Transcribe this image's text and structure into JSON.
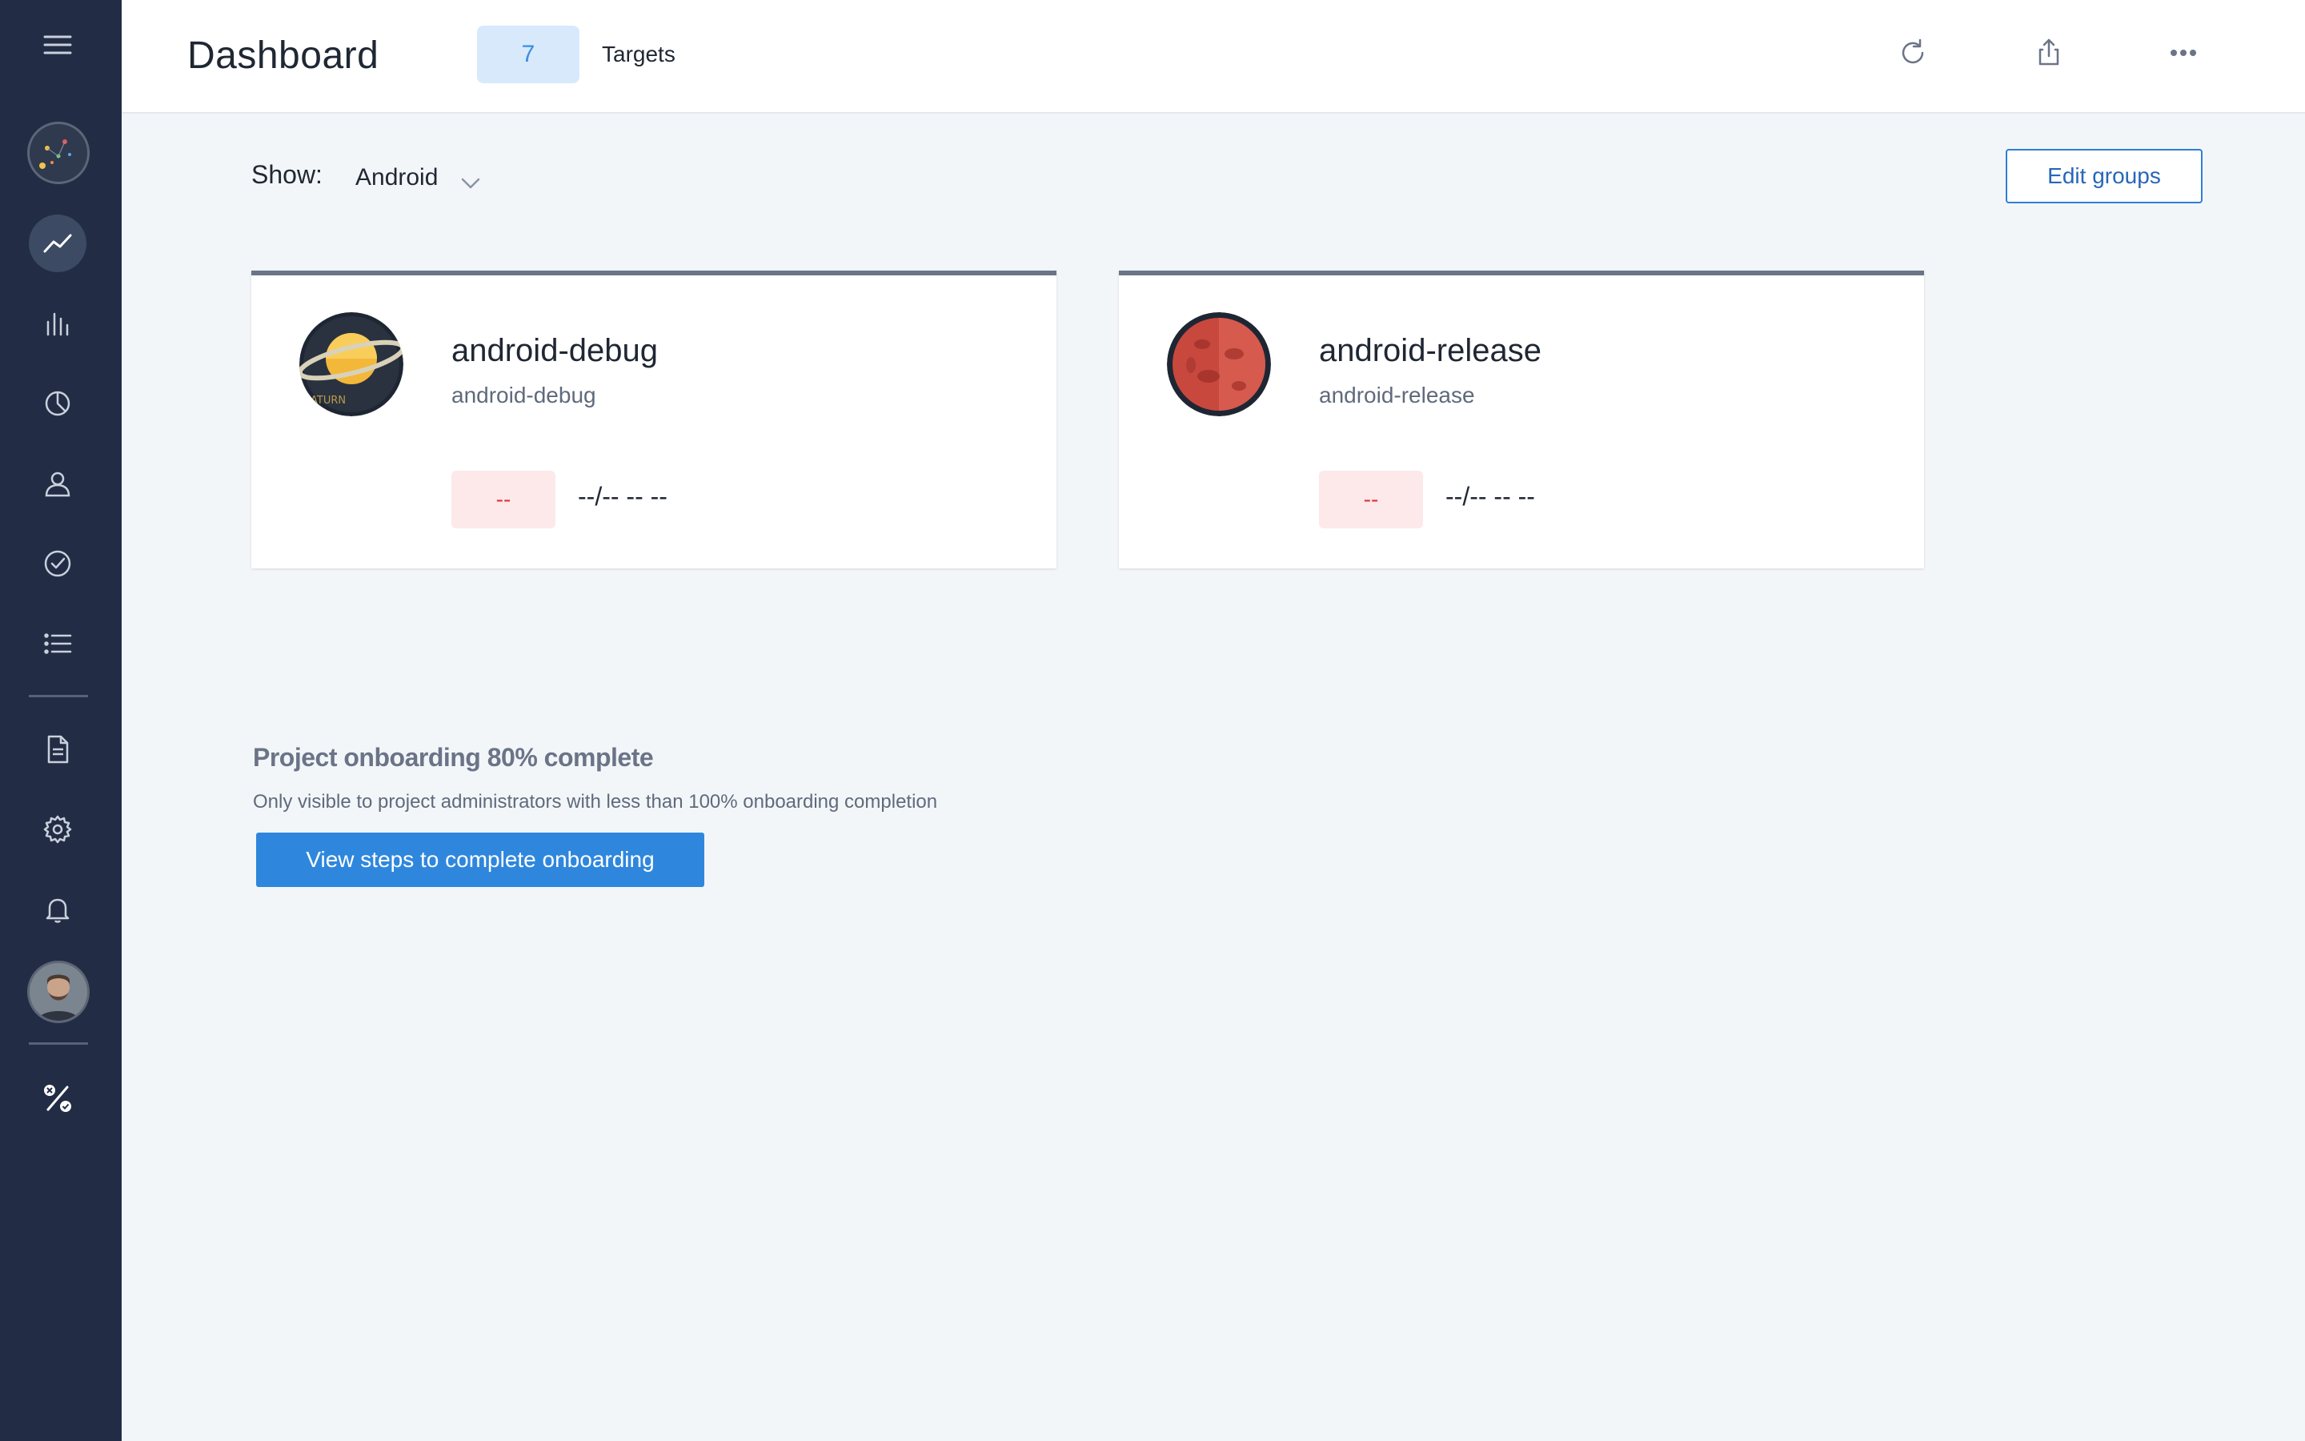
{
  "header": {
    "title": "Dashboard",
    "targets_count": "7",
    "targets_label": "Targets"
  },
  "sidebar": {
    "items": [
      {
        "icon": "menu-icon"
      },
      {
        "icon": "project-logo"
      },
      {
        "icon": "trending-icon",
        "active": true
      },
      {
        "icon": "bar-chart-icon"
      },
      {
        "icon": "pie-chart-icon"
      },
      {
        "icon": "user-icon"
      },
      {
        "icon": "check-circle-icon"
      },
      {
        "icon": "list-icon"
      },
      {
        "icon": "document-icon"
      },
      {
        "icon": "gear-icon"
      },
      {
        "icon": "bell-icon"
      },
      {
        "icon": "user-avatar"
      },
      {
        "icon": "percent-status-icon"
      }
    ]
  },
  "toolbar": {
    "show_label": "Show:",
    "show_value": "Android",
    "edit_groups_label": "Edit groups"
  },
  "cards": [
    {
      "name": "android-debug",
      "subtitle": "android-debug",
      "badge": "--",
      "date": "--/-- -- --",
      "avatar_icon": "saturn-planet-icon"
    },
    {
      "name": "android-release",
      "subtitle": "android-release",
      "badge": "--",
      "date": "--/-- -- --",
      "avatar_icon": "red-planet-icon"
    }
  ],
  "onboarding": {
    "title": "Project onboarding 80% complete",
    "progress_percent": 80,
    "description": "Only visible to project administrators with less than 100% onboarding completion",
    "button_label": "View steps to complete onboarding"
  },
  "colors": {
    "sidebar_bg": "#222d45",
    "accent": "#2f87dd",
    "badge_bg": "#fde9ea",
    "badge_text": "#e0323c"
  }
}
